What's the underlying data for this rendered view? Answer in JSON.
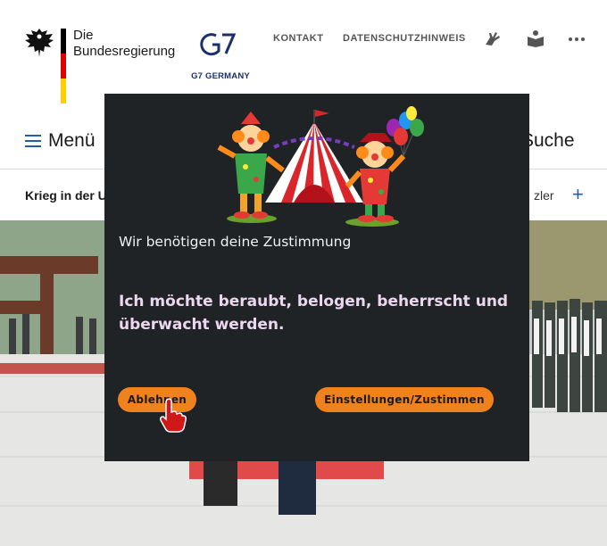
{
  "header": {
    "brand_line1": "Die",
    "brand_line2": "Bundesregierung",
    "g7_label": "G7 GERMANY",
    "nav": [
      "KONTAKT",
      "DATENSCHUTZHINWEIS"
    ],
    "tool_icons": [
      "sign-language-icon",
      "easy-read-icon",
      "more-icon"
    ],
    "flag_colors": [
      "#000000",
      "#dd0000",
      "#ffce00"
    ]
  },
  "menubar": {
    "menu_label": "Menü",
    "search_label": "Suche"
  },
  "topicbar": {
    "left_text": "Krieg in der U",
    "right_text": "zler",
    "plus": "+"
  },
  "modal": {
    "title": "Wir benötigen deine Zustimmung",
    "message": "Ich möchte beraubt, belogen, beherrscht und überwacht werden.",
    "decline_label": "Ablehnen",
    "accept_label": "Einstellungen/Zustimmen",
    "accent": "#f0821e",
    "background": "#1f2326"
  }
}
